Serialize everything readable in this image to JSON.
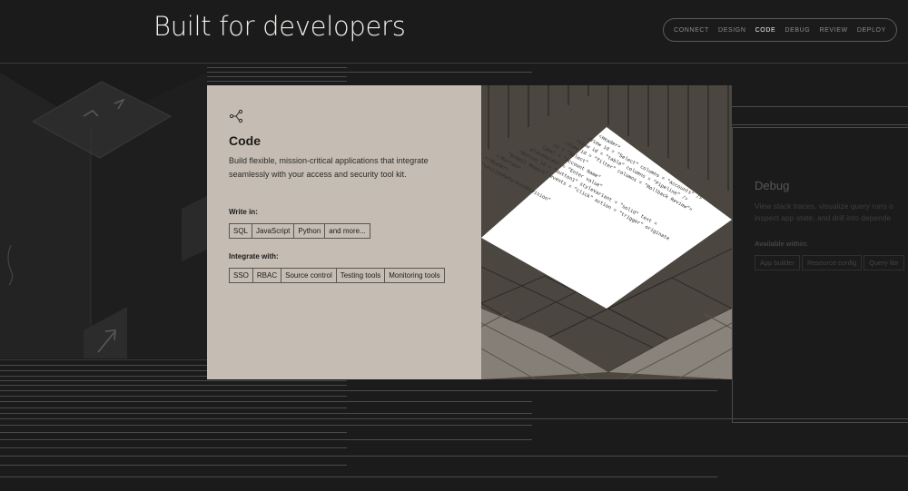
{
  "header": {
    "title": "Built for developers",
    "nav": [
      {
        "label": "CONNECT",
        "active": false
      },
      {
        "label": "DESIGN",
        "active": false
      },
      {
        "label": "CODE",
        "active": true
      },
      {
        "label": "DEBUG",
        "active": false
      },
      {
        "label": "REVIEW",
        "active": false
      },
      {
        "label": "DEPLOY",
        "active": false
      }
    ]
  },
  "code_card": {
    "icon": "branch-icon",
    "title": "Code",
    "description": "Build flexible, mission-critical applications that integrate seamlessly with your access and security tool kit.",
    "write_in_label": "Write in:",
    "write_in": [
      "SQL",
      "JavaScript",
      "Python",
      "and more..."
    ],
    "integrate_label": "Integrate with:",
    "integrate": [
      "SSO",
      "RBAC",
      "Source control",
      "Testing tools",
      "Monitoring tools"
    ]
  },
  "debug_card": {
    "title": "Debug",
    "description_line1": "View stack traces, visualize query runs o",
    "description_line2": "inspect app state, and drill into depende",
    "available_label": "Available within:",
    "available": [
      "App builder",
      "Resource config",
      "Query libr"
    ]
  },
  "colors": {
    "background": "#1b1b1b",
    "card_left": "#c5bdb4",
    "card_right": "#4c4640"
  }
}
